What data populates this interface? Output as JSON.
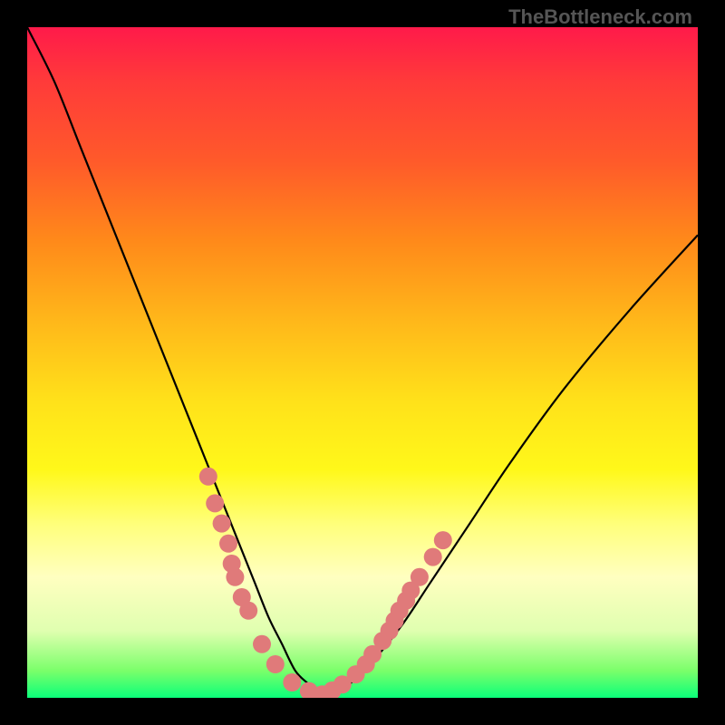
{
  "watermark": "TheBottleneck.com",
  "colors": {
    "curve": "#000000",
    "marker_fill": "#e07a7a",
    "marker_stroke": "#c86868",
    "gradient_top": "#ff1a4a",
    "gradient_bottom": "#0aff7a",
    "frame": "#000000"
  },
  "chart_data": {
    "type": "line",
    "title": "",
    "xlabel": "",
    "ylabel": "",
    "xlim": [
      0,
      100
    ],
    "ylim": [
      0,
      100
    ],
    "grid": false,
    "legend": "none",
    "series": [
      {
        "name": "bottleneck-curve",
        "x": [
          0,
          4,
          8,
          12,
          16,
          20,
          24,
          28,
          30,
          32,
          34,
          36,
          38,
          40,
          42,
          44,
          48,
          52,
          56,
          60,
          66,
          72,
          80,
          90,
          100
        ],
        "y": [
          100,
          92,
          82,
          72,
          62,
          52,
          42,
          32,
          27,
          22,
          17,
          12,
          8,
          4,
          2,
          0,
          2,
          6,
          11,
          17,
          26,
          35,
          46,
          58,
          69
        ]
      }
    ],
    "markers": [
      {
        "x": 27,
        "y": 33
      },
      {
        "x": 28,
        "y": 29
      },
      {
        "x": 29,
        "y": 26
      },
      {
        "x": 30,
        "y": 23
      },
      {
        "x": 30.5,
        "y": 20
      },
      {
        "x": 31,
        "y": 18
      },
      {
        "x": 32,
        "y": 15
      },
      {
        "x": 33,
        "y": 13
      },
      {
        "x": 35,
        "y": 8
      },
      {
        "x": 37,
        "y": 5
      },
      {
        "x": 39.5,
        "y": 2.3
      },
      {
        "x": 42,
        "y": 1
      },
      {
        "x": 44,
        "y": 0.5
      },
      {
        "x": 45.5,
        "y": 1.1
      },
      {
        "x": 47,
        "y": 2
      },
      {
        "x": 49,
        "y": 3.5
      },
      {
        "x": 50.5,
        "y": 5
      },
      {
        "x": 51.5,
        "y": 6.5
      },
      {
        "x": 53,
        "y": 8.5
      },
      {
        "x": 54,
        "y": 10
      },
      {
        "x": 54.8,
        "y": 11.5
      },
      {
        "x": 55.5,
        "y": 13
      },
      {
        "x": 56.5,
        "y": 14.5
      },
      {
        "x": 57.2,
        "y": 16
      },
      {
        "x": 58.5,
        "y": 18
      },
      {
        "x": 60.5,
        "y": 21
      },
      {
        "x": 62,
        "y": 23.5
      }
    ],
    "marker_radius_px": 10
  }
}
